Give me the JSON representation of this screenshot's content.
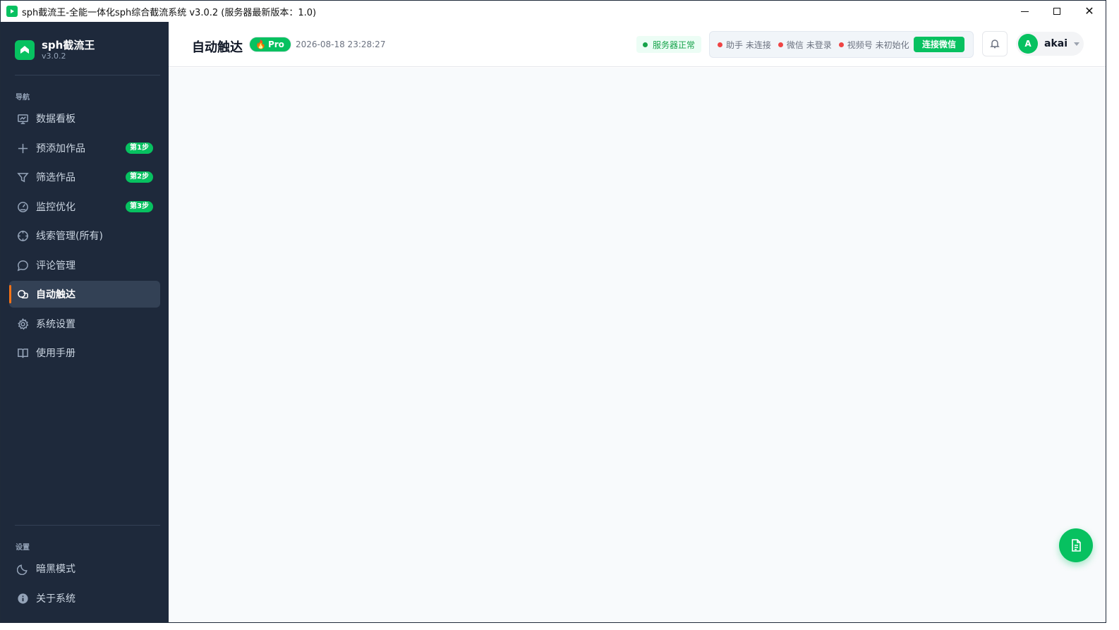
{
  "window": {
    "title": "sph截流王-全能一体化sph综合截流系统 v3.0.2 (服务器最新版本：1.0)",
    "controls": {
      "minimize": "minimize-icon",
      "maximize": "maximize-icon",
      "close": "✕"
    }
  },
  "brand": {
    "name": "sph截流王",
    "version": "v3.0.2"
  },
  "sidebar": {
    "nav_label": "导航",
    "items": [
      {
        "label": "数据看板",
        "icon": "chart-board-icon"
      },
      {
        "label": "预添加作品",
        "icon": "plus-icon",
        "badge": "第1步"
      },
      {
        "label": "筛选作品",
        "icon": "filter-icon",
        "badge": "第2步"
      },
      {
        "label": "监控优化",
        "icon": "gauge-icon",
        "badge": "第3步"
      },
      {
        "label": "线索管理(所有)",
        "icon": "crosshair-icon"
      },
      {
        "label": "评论管理",
        "icon": "comment-icon"
      },
      {
        "label": "自动触达",
        "icon": "link-chat-icon",
        "active": true
      },
      {
        "label": "系统设置",
        "icon": "gear-icon"
      },
      {
        "label": "使用手册",
        "icon": "book-icon"
      }
    ],
    "settings_label": "设置",
    "settings_items": [
      {
        "label": "暗黑模式",
        "icon": "moon-icon"
      },
      {
        "label": "关于系统",
        "icon": "info-icon"
      }
    ]
  },
  "header": {
    "page_title": "自动触达",
    "pro_badge": "Pro",
    "timestamp": "2026-08-18 23:28:27",
    "server_status": "服务器正常",
    "connections": [
      {
        "name": "助手",
        "status": "未连接"
      },
      {
        "name": "微信",
        "status": "未登录"
      },
      {
        "name": "视频号",
        "status": "未初始化"
      }
    ],
    "connect_button": "连接微信",
    "user": {
      "avatar_letter": "A",
      "name": "akai"
    }
  },
  "colors": {
    "accent": "#07c160",
    "sidebar_bg": "#1e293b",
    "active_indicator": "#f97316",
    "status_red": "#ef4444"
  }
}
